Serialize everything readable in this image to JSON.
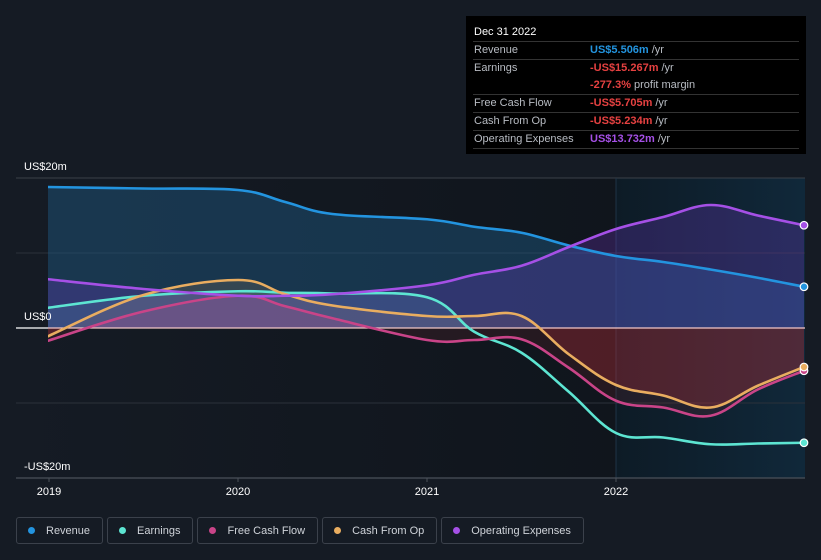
{
  "tooltip": {
    "date": "Dec 31 2022",
    "rows": [
      {
        "label": "Revenue",
        "value": "US$5.506m",
        "unit": "/yr",
        "color": "#2394df"
      },
      {
        "label": "Earnings",
        "value": "-US$15.267m",
        "unit": "/yr",
        "color": "#e64141"
      },
      {
        "label": "",
        "value": "-277.3%",
        "unit": "profit margin",
        "color": "#e64141"
      },
      {
        "label": "Free Cash Flow",
        "value": "-US$5.705m",
        "unit": "/yr",
        "color": "#e64141"
      },
      {
        "label": "Cash From Op",
        "value": "-US$5.234m",
        "unit": "/yr",
        "color": "#e64141"
      },
      {
        "label": "Operating Expenses",
        "value": "US$13.732m",
        "unit": "/yr",
        "color": "#a550e6"
      }
    ]
  },
  "legend": [
    {
      "label": "Revenue",
      "color": "#2394df"
    },
    {
      "label": "Earnings",
      "color": "#5de5d2"
    },
    {
      "label": "Free Cash Flow",
      "color": "#c94488"
    },
    {
      "label": "Cash From Op",
      "color": "#e9ad60"
    },
    {
      "label": "Operating Expenses",
      "color": "#a550e6"
    }
  ],
  "chart_data": {
    "type": "area",
    "title": "",
    "xlabel": "",
    "ylabel": "",
    "units": "US$ millions",
    "xlim": [
      2018.85,
      2023.0
    ],
    "ylim": [
      -20,
      20
    ],
    "y_ticks": [
      {
        "value": 20,
        "label": "US$20m"
      },
      {
        "value": 0,
        "label": "US$0"
      },
      {
        "value": -20,
        "label": "-US$20m"
      }
    ],
    "x_ticks": [
      {
        "value": 2019,
        "label": "2019"
      },
      {
        "value": 2020,
        "label": "2020"
      },
      {
        "value": 2021,
        "label": "2021"
      },
      {
        "value": 2022,
        "label": "2022"
      }
    ],
    "grid": true,
    "highlight_start": 2022.0,
    "legend_position": "bottom-left",
    "x": [
      2019.0,
      2019.5,
      2020.0,
      2020.25,
      2020.5,
      2021.0,
      2021.25,
      2021.5,
      2021.75,
      2022.0,
      2022.25,
      2022.5,
      2022.75,
      2023.0
    ],
    "series": [
      {
        "name": "Revenue",
        "color": "#2394df",
        "values": [
          18.8,
          18.6,
          18.4,
          16.8,
          15.2,
          14.5,
          13.5,
          12.7,
          11.0,
          9.6,
          8.8,
          7.8,
          6.7,
          5.5
        ]
      },
      {
        "name": "Earnings",
        "color": "#5de5d2",
        "values": [
          2.7,
          4.3,
          4.9,
          4.7,
          4.6,
          4.1,
          -0.5,
          -3.3,
          -8.5,
          -14.0,
          -14.6,
          -15.5,
          -15.4,
          -15.3
        ]
      },
      {
        "name": "Free Cash Flow",
        "color": "#c94488",
        "values": [
          -1.7,
          2.2,
          4.3,
          2.9,
          1.3,
          -1.6,
          -1.6,
          -1.5,
          -5.3,
          -9.7,
          -10.6,
          -11.7,
          -8.2,
          -5.7
        ]
      },
      {
        "name": "Cash From Op",
        "color": "#e9ad60",
        "values": [
          -1.1,
          4.4,
          6.4,
          4.5,
          3.0,
          1.6,
          1.6,
          1.6,
          -3.5,
          -7.6,
          -9.0,
          -10.6,
          -7.7,
          -5.2
        ]
      },
      {
        "name": "Operating Expenses",
        "color": "#a550e6",
        "values": [
          6.5,
          5.2,
          4.3,
          4.3,
          4.5,
          5.7,
          7.1,
          8.3,
          10.8,
          13.2,
          14.8,
          16.4,
          15.0,
          13.7
        ]
      }
    ]
  }
}
